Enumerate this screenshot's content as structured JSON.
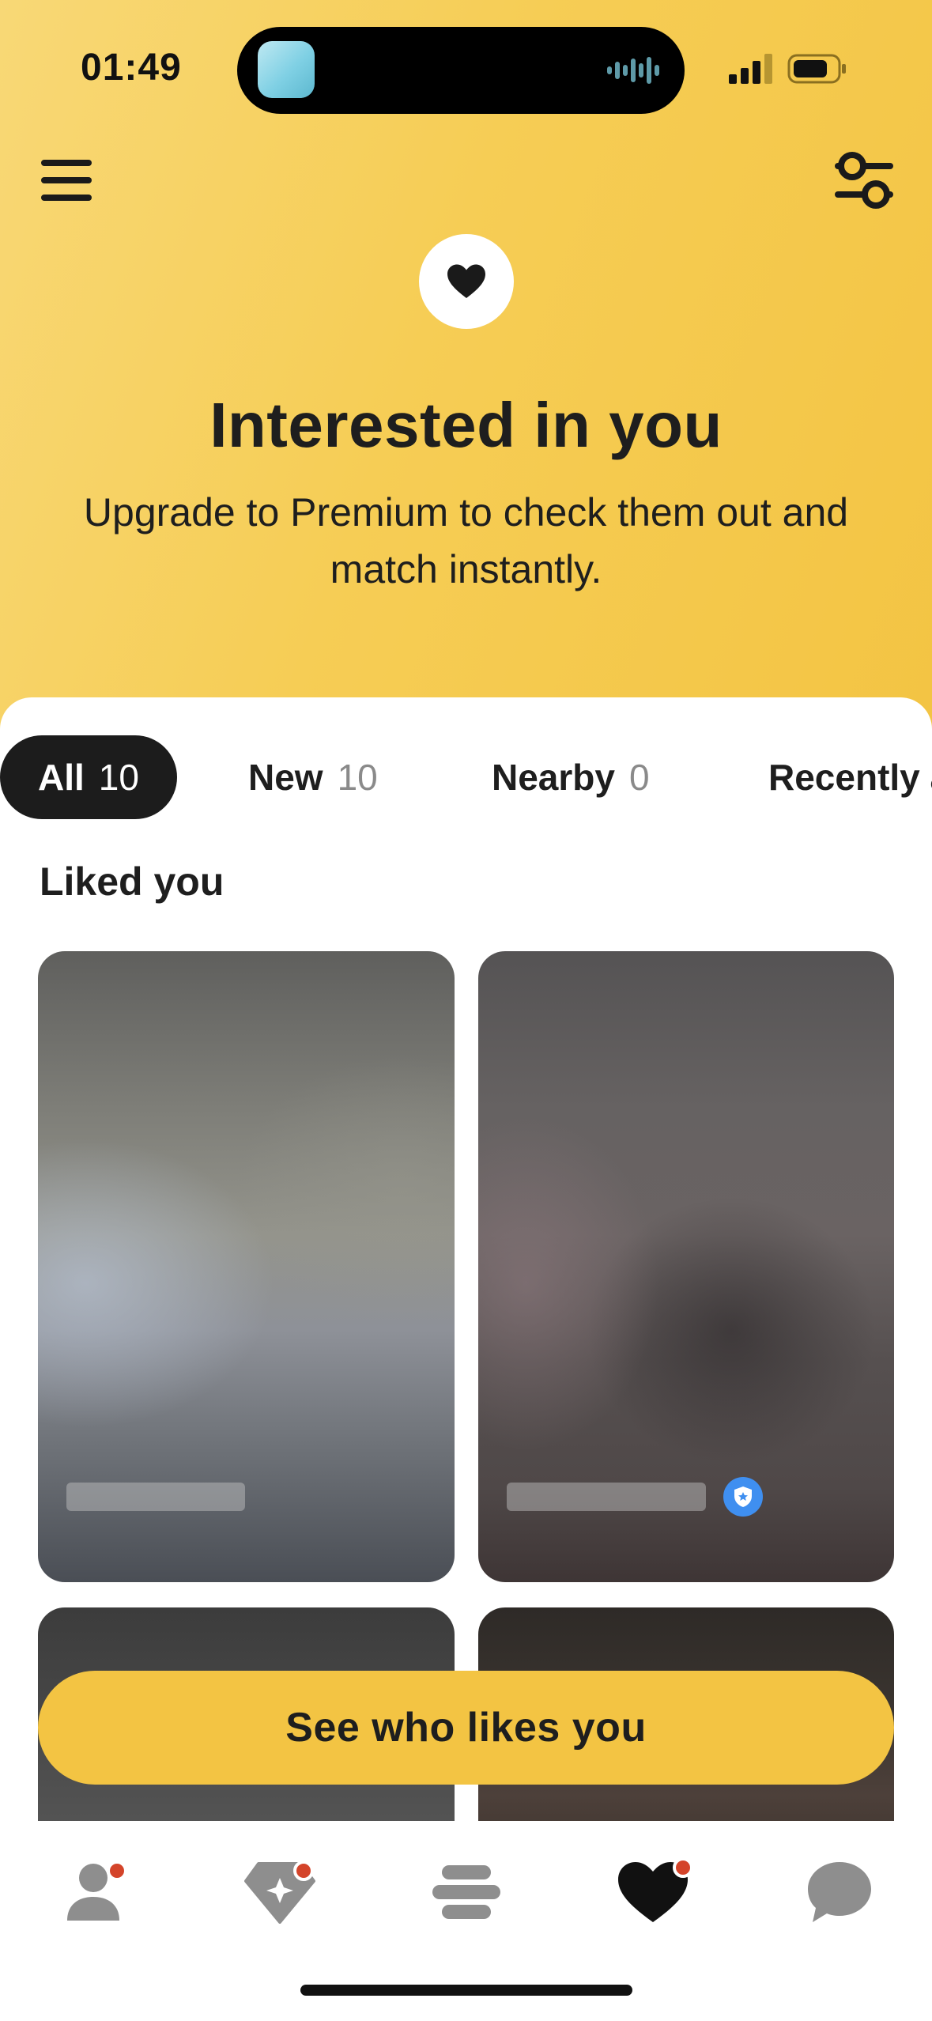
{
  "status_bar": {
    "time": "01:49"
  },
  "header": {
    "menu_icon": "hamburger-menu-icon",
    "filter_icon": "filter-sliders-icon"
  },
  "hero": {
    "icon": "heart-icon",
    "title": "Interested in you",
    "subtitle": "Upgrade to Premium to check them out and match instantly."
  },
  "tabs": [
    {
      "label": "All",
      "count": "10",
      "active": true
    },
    {
      "label": "New",
      "count": "10",
      "active": false
    },
    {
      "label": "Nearby",
      "count": "0",
      "active": false
    },
    {
      "label": "Recently a",
      "count": "",
      "active": false
    }
  ],
  "section": {
    "title": "Liked you"
  },
  "cards": [
    {
      "blurred": true,
      "verified": false
    },
    {
      "blurred": true,
      "verified": true
    },
    {
      "blurred": true,
      "verified": false
    },
    {
      "blurred": true,
      "verified": false
    }
  ],
  "cta": {
    "label": "See who likes you"
  },
  "bottom_nav": [
    {
      "icon": "profile-icon",
      "has_notification": true,
      "active": false
    },
    {
      "icon": "discover-diamond-icon",
      "has_notification": true,
      "active": false
    },
    {
      "icon": "people-stack-icon",
      "has_notification": false,
      "active": false
    },
    {
      "icon": "liked-you-heart-icon",
      "has_notification": true,
      "active": true
    },
    {
      "icon": "chat-bubble-icon",
      "has_notification": false,
      "active": false
    }
  ],
  "colors": {
    "brand_yellow": "#f3c443",
    "notification_red": "#d4442a",
    "verified_blue": "#3f8ff0",
    "active_tab_bg": "#1c1c1c"
  }
}
